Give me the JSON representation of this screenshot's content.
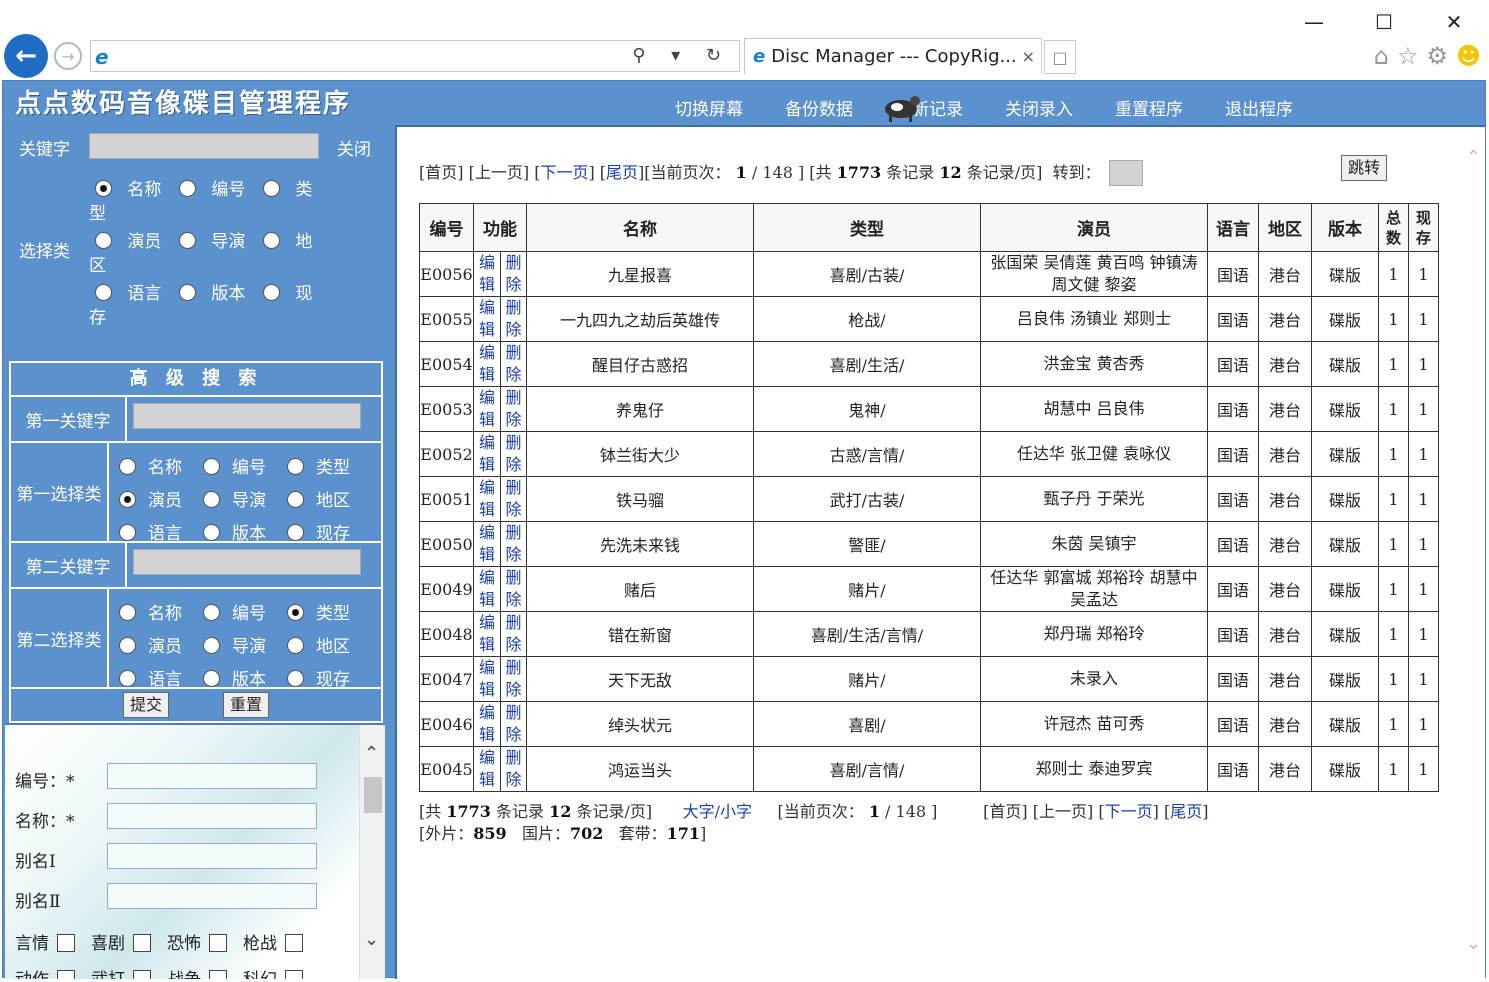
{
  "browser": {
    "window_controls": [
      "—",
      "☐",
      "✕"
    ],
    "tab_title": "Disc Manager --- CopyRig...",
    "tab_close": "×",
    "address_tools": "⚲ ▾ ↻"
  },
  "app": {
    "title": "点点数码音像碟目管理程序",
    "menu": [
      "切换屏幕",
      "备份数据",
      "刷新记录",
      "关闭录入",
      "重置程序",
      "退出程序"
    ]
  },
  "search": {
    "keyword_label": "关键字",
    "close_label": "关闭",
    "class_label": "选择类",
    "options": [
      {
        "label": "名称",
        "wrap": "",
        "selected": true
      },
      {
        "label": "编号",
        "wrap": "",
        "selected": false
      },
      {
        "label": "类",
        "wrap": "型",
        "selected": false
      },
      {
        "label": "演员",
        "wrap": "",
        "selected": false
      },
      {
        "label": "导演",
        "wrap": "",
        "selected": false
      },
      {
        "label": "地",
        "wrap": "区",
        "selected": false
      },
      {
        "label": "语言",
        "wrap": "",
        "selected": false
      },
      {
        "label": "版本",
        "wrap": "",
        "selected": false
      },
      {
        "label": "现",
        "wrap": "存",
        "selected": false
      }
    ]
  },
  "advanced": {
    "title": "高 级 搜 索",
    "first_keyword_label": "第一关键字",
    "first_class_label": "第一选择类",
    "second_keyword_label": "第二关键字",
    "second_class_label": "第二选择类",
    "options": [
      "名称",
      "编号",
      "类型",
      "演员",
      "导演",
      "地区",
      "语言",
      "版本",
      "现存"
    ],
    "first_selected": "演员",
    "second_selected": "类型",
    "submit_label": "提交",
    "reset_label": "重置"
  },
  "entry": {
    "fields": [
      {
        "label": "编号：*"
      },
      {
        "label": "名称：*"
      },
      {
        "label": "别名Ⅰ"
      },
      {
        "label": "别名Ⅱ"
      }
    ],
    "genres_row1": [
      "言情",
      "喜剧",
      "恐怖",
      "枪战"
    ],
    "genres_row2": [
      "动作",
      "武打",
      "战争",
      "科幻"
    ]
  },
  "pager": {
    "first": "首页",
    "prev": "上一页",
    "next": "下一页",
    "last": "尾页",
    "current_label": "当前页次：",
    "current_page": "1",
    "total_pages": "148",
    "total_label": "共",
    "total_records": "1773",
    "records_label": "条记录",
    "per_page": "12",
    "per_page_label": "条记录/页",
    "goto_label": "转到：",
    "goto_button": "跳转"
  },
  "table": {
    "headers": [
      "编号",
      "功能",
      "名称",
      "类型",
      "演员",
      "语言",
      "地区",
      "版本",
      "总数",
      "现存"
    ],
    "edit_label": [
      "编",
      "辑"
    ],
    "delete_label": [
      "删",
      "除"
    ],
    "rows": [
      {
        "id": "E0056",
        "name": "九星报喜",
        "type": "喜剧/古装/",
        "actors": "张国荣 吴倩莲 黄百鸣 钟镇涛 周文健 黎姿",
        "lang": "国语",
        "region": "港台",
        "version": "碟版",
        "total": "1",
        "stock": "1"
      },
      {
        "id": "E0055",
        "name": "一九四九之劫后英雄传",
        "type": "枪战/",
        "actors": "吕良伟 汤镇业 郑则士",
        "lang": "国语",
        "region": "港台",
        "version": "碟版",
        "total": "1",
        "stock": "1"
      },
      {
        "id": "E0054",
        "name": "醒目仔古惑招",
        "type": "喜剧/生活/",
        "actors": "洪金宝 黄杏秀",
        "lang": "国语",
        "region": "港台",
        "version": "碟版",
        "total": "1",
        "stock": "1"
      },
      {
        "id": "E0053",
        "name": "养鬼仔",
        "type": "鬼神/",
        "actors": "胡慧中 吕良伟",
        "lang": "国语",
        "region": "港台",
        "version": "碟版",
        "total": "1",
        "stock": "1"
      },
      {
        "id": "E0052",
        "name": "钵兰街大少",
        "type": "古惑/言情/",
        "actors": "任达华 张卫健 袁咏仪",
        "lang": "国语",
        "region": "港台",
        "version": "碟版",
        "total": "1",
        "stock": "1"
      },
      {
        "id": "E0051",
        "name": "铁马骝",
        "type": "武打/古装/",
        "actors": "甄子丹 于荣光",
        "lang": "国语",
        "region": "港台",
        "version": "碟版",
        "total": "1",
        "stock": "1"
      },
      {
        "id": "E0050",
        "name": "先洗未来钱",
        "type": "警匪/",
        "actors": "朱茵 吴镇宇",
        "lang": "国语",
        "region": "港台",
        "version": "碟版",
        "total": "1",
        "stock": "1"
      },
      {
        "id": "E0049",
        "name": "赌后",
        "type": "赌片/",
        "actors": "任达华 郭富城 郑裕玲 胡慧中 吴孟达",
        "lang": "国语",
        "region": "港台",
        "version": "碟版",
        "total": "1",
        "stock": "1"
      },
      {
        "id": "E0048",
        "name": "错在新窗",
        "type": "喜剧/生活/言情/",
        "actors": "郑丹瑞 郑裕玲",
        "lang": "国语",
        "region": "港台",
        "version": "碟版",
        "total": "1",
        "stock": "1"
      },
      {
        "id": "E0047",
        "name": "天下无敌",
        "type": "赌片/",
        "actors": "未录入",
        "lang": "国语",
        "region": "港台",
        "version": "碟版",
        "total": "1",
        "stock": "1"
      },
      {
        "id": "E0046",
        "name": "绰头状元",
        "type": "喜剧/",
        "actors": "许冠杰 苗可秀",
        "lang": "国语",
        "region": "港台",
        "version": "碟版",
        "total": "1",
        "stock": "1"
      },
      {
        "id": "E0045",
        "name": "鸿运当头",
        "type": "喜剧/言情/",
        "actors": "郑则士 泰迪罗宾",
        "lang": "国语",
        "region": "港台",
        "version": "碟版",
        "total": "1",
        "stock": "1"
      }
    ]
  },
  "footer": {
    "font_toggle": "大字/小字",
    "foreign_label": "外片：",
    "foreign_count": "859",
    "domestic_label": "国片：",
    "domestic_count": "702",
    "tape_label": "套带：",
    "tape_count": "171"
  }
}
